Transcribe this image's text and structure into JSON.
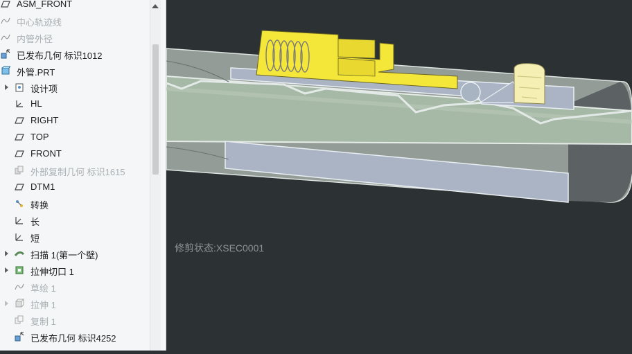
{
  "model_tree": {
    "items": [
      {
        "label": "ASM_FRONT",
        "dim": false,
        "expand": false,
        "icon": "datum-plane-icon"
      },
      {
        "label": "中心轨迹线",
        "dim": true,
        "expand": false,
        "icon": "sketch-icon"
      },
      {
        "label": "内管外径",
        "dim": true,
        "expand": false,
        "icon": "sketch-icon"
      },
      {
        "label": "已发布几何 标识1012",
        "dim": false,
        "expand": false,
        "icon": "publish-geometry-icon"
      },
      {
        "label": "外管.PRT",
        "dim": false,
        "expand": false,
        "icon": "part-icon"
      },
      {
        "label": "设计项",
        "dim": false,
        "expand": true,
        "icon": "design-items-icon"
      },
      {
        "label": "HL",
        "dim": false,
        "expand": false,
        "icon": "coordinate-system-icon"
      },
      {
        "label": "RIGHT",
        "dim": false,
        "expand": false,
        "icon": "datum-plane-icon"
      },
      {
        "label": "TOP",
        "dim": false,
        "expand": false,
        "icon": "datum-plane-icon"
      },
      {
        "label": "FRONT",
        "dim": false,
        "expand": false,
        "icon": "datum-plane-icon"
      },
      {
        "label": "外部复制几何 标识1615",
        "dim": true,
        "expand": false,
        "icon": "copy-geometry-icon"
      },
      {
        "label": "DTM1",
        "dim": false,
        "expand": false,
        "icon": "datum-plane-icon"
      },
      {
        "label": "转换",
        "dim": false,
        "expand": false,
        "icon": "transform-icon"
      },
      {
        "label": "长",
        "dim": false,
        "expand": false,
        "icon": "csys-icon"
      },
      {
        "label": "短",
        "dim": false,
        "expand": false,
        "icon": "csys-icon"
      },
      {
        "label": "扫描 1(第一个壁)",
        "dim": false,
        "expand": true,
        "icon": "sweep-icon"
      },
      {
        "label": "拉伸切口 1",
        "dim": false,
        "expand": true,
        "icon": "extrude-cut-icon"
      },
      {
        "label": "草绘 1",
        "dim": true,
        "expand": false,
        "icon": "sketch-icon"
      },
      {
        "label": "拉伸 1",
        "dim": true,
        "expand": true,
        "icon": "extrude-icon"
      },
      {
        "label": "复制 1",
        "dim": true,
        "expand": false,
        "icon": "copy-icon"
      },
      {
        "label": "已发布几何 标识4252",
        "dim": false,
        "expand": false,
        "icon": "publish-geometry-icon"
      },
      {
        "label": "",
        "dim": true,
        "expand": false,
        "icon": "sketch-icon"
      }
    ]
  },
  "viewport": {
    "status_text": "修剪状态:XSEC0001",
    "colors": {
      "background": "#2c3133",
      "tube": "#a9b9aa",
      "insert": "#f5e63a",
      "section": "#aab4c4"
    }
  }
}
